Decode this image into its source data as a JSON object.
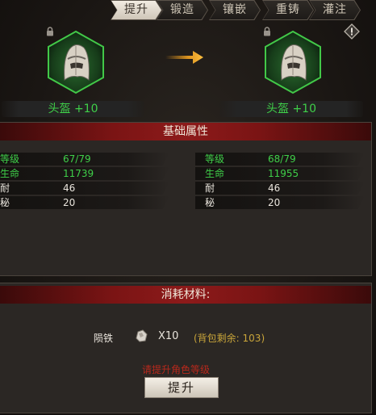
{
  "tabs": [
    {
      "label": "提升",
      "active": true
    },
    {
      "label": "锻造",
      "active": false
    },
    {
      "label": "镶嵌",
      "active": false
    },
    {
      "label": "重铸",
      "active": false
    },
    {
      "label": "灌注",
      "active": false
    }
  ],
  "current_item": {
    "name": "头盔 +10",
    "icon": "helmet-icon"
  },
  "next_item": {
    "name": "头盔 +10",
    "icon": "helmet-icon"
  },
  "base_attributes": {
    "title": "基础属性",
    "current": [
      {
        "label": "等级",
        "value": "67/79"
      },
      {
        "label": "生命",
        "value": "11739"
      },
      {
        "label": "耐",
        "value": "46"
      },
      {
        "label": "秘",
        "value": "20"
      }
    ],
    "next": [
      {
        "label": "等级",
        "value": "68/79"
      },
      {
        "label": "生命",
        "value": "11955"
      },
      {
        "label": "耐",
        "value": "46"
      },
      {
        "label": "秘",
        "value": "20"
      }
    ]
  },
  "materials": {
    "title": "消耗材料:",
    "item_name": "陨铁",
    "count": "X10",
    "remaining": "(背包剩余: 103)",
    "warning": "请提升角色等级"
  },
  "upgrade_button": "提升",
  "colors": {
    "stat_green": "#3fcf49",
    "title_red": "#8d1a1a",
    "warning_red": "#b8281c",
    "remain_gold": "#c9a53a",
    "arrow_orange": "#f0a020"
  }
}
